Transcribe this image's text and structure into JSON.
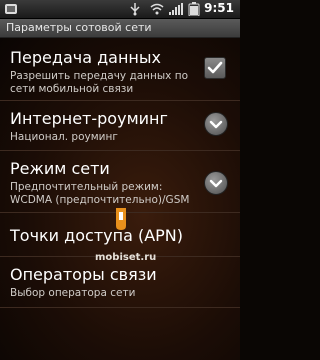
{
  "status_bar": {
    "time": "9:51"
  },
  "header": {
    "title": "Параметры сотовой сети"
  },
  "settings": [
    {
      "label": "Передача данных",
      "summary": "Разрешить передачу данных по сети мобильной связи",
      "control": "checkbox",
      "checked": true
    },
    {
      "label": "Интернет-роуминг",
      "summary": "Национал. роуминг",
      "control": "dropdown"
    },
    {
      "label": "Режим сети",
      "summary": "Предпочтительный режим: WCDMA (предпочтительно)/GSM",
      "control": "dropdown"
    },
    {
      "label": "Точки доступа (APN)"
    },
    {
      "label": "Операторы связи",
      "summary": "Выбор оператора сети"
    }
  ],
  "watermark": {
    "text": "mobiset.ru"
  },
  "icons": {
    "notification": "notification-icon",
    "usb": "usb-icon",
    "wifi": "wifi-icon",
    "signal": "signal-icon",
    "battery": "battery-icon",
    "check": "check-icon",
    "chevron": "chevron-down-icon"
  }
}
